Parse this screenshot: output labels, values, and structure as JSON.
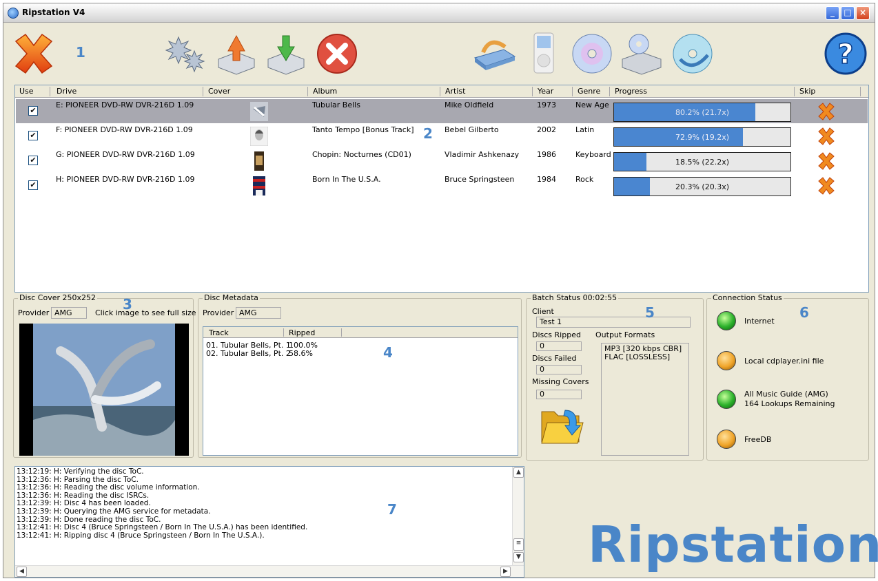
{
  "window": {
    "title": "Ripstation V4",
    "buttons": {
      "minimize": "_",
      "maximize": "□",
      "close": "×"
    }
  },
  "toolbar": {
    "steps": [
      "1",
      "2",
      "3",
      "4",
      "5",
      "6",
      "7"
    ],
    "icons": [
      "exit-icon",
      "settings-icon",
      "eject-icon",
      "load-icon",
      "cancel-icon",
      "drive-icon",
      "ipod-icon",
      "cd-icon",
      "rip-to-drive-icon",
      "rip-cd-icon",
      "help-icon"
    ]
  },
  "table": {
    "headers": [
      "Use",
      "Drive",
      "Cover",
      "Album",
      "Artist",
      "Year",
      "Genre",
      "Progress",
      "Skip"
    ],
    "rows": [
      {
        "use": "✔",
        "drive": "E: PIONEER  DVD-RW  DVR-216D 1.09",
        "album": "Tubular Bells",
        "artist": "Mike Oldfield",
        "year": "1973",
        "genre": "New Age",
        "progress": 0.802,
        "progress_text": "80.2% (21.7x)"
      },
      {
        "use": "✔",
        "drive": "F: PIONEER  DVD-RW  DVR-216D 1.09",
        "album": "Tanto Tempo [Bonus Track]",
        "artist": "Bebel Gilberto",
        "year": "2002",
        "genre": "Latin",
        "progress": 0.729,
        "progress_text": "72.9% (19.2x)"
      },
      {
        "use": "✔",
        "drive": "G: PIONEER  DVD-RW  DVR-216D 1.09",
        "album": "Chopin: Nocturnes (CD01)",
        "artist": "Vladimir Ashkenazy",
        "year": "1986",
        "genre": "Keyboard",
        "progress": 0.185,
        "progress_text": "18.5% (22.2x)"
      },
      {
        "use": "✔",
        "drive": "H: PIONEER  DVD-RW  DVR-216D 1.09",
        "album": "Born In The U.S.A.",
        "artist": "Bruce Springsteen",
        "year": "1984",
        "genre": "Rock",
        "progress": 0.203,
        "progress_text": "20.3% (20.3x)"
      }
    ]
  },
  "disc_cover": {
    "title": "Disc Cover 250x252",
    "provider_label": "Provider",
    "provider": "AMG",
    "hint": "Click image to see full size"
  },
  "metadata": {
    "title": "Disc Metadata",
    "provider_label": "Provider",
    "provider": "AMG",
    "headers": [
      "Track",
      "Ripped"
    ],
    "tracks": [
      {
        "track": "01. Tubular Bells, Pt. 1",
        "ripped": "100.0%"
      },
      {
        "track": "02. Tubular Bells, Pt. 2",
        "ripped": "58.6%"
      }
    ]
  },
  "batch": {
    "title": "Batch Status 00:02:55",
    "client_label": "Client",
    "client": "Test 1",
    "discs_ripped_label": "Discs Ripped",
    "discs_ripped": "0",
    "discs_failed_label": "Discs Failed",
    "discs_failed": "0",
    "missing_covers_label": "Missing Covers",
    "missing_covers": "0",
    "output_formats_label": "Output Formats",
    "output_formats": [
      "MP3 [320 kbps CBR]",
      "FLAC [LOSSLESS]"
    ]
  },
  "connection": {
    "title": "Connection Status",
    "items": [
      {
        "status": "green",
        "label": "Internet",
        "sub": ""
      },
      {
        "status": "orange",
        "label": "Local cdplayer.ini file",
        "sub": ""
      },
      {
        "status": "green",
        "label": "All Music Guide (AMG)",
        "sub": "164 Lookups Remaining"
      },
      {
        "status": "orange",
        "label": "FreeDB",
        "sub": ""
      }
    ]
  },
  "log": [
    "13:12:19: H: Verifying the disc ToC.",
    "13:12:36: H: Parsing the disc ToC.",
    "13:12:36: H: Reading the disc volume information.",
    "13:12:36: H: Reading the disc ISRCs.",
    "13:12:39: H: Disc 4 has been loaded.",
    "13:12:39: H: Querying the AMG service for metadata.",
    "13:12:39: H: Done reading the disc ToC.",
    "13:12:41: H: Disc 4 (Bruce Springsteen / Born In The U.S.A.) has been identified.",
    "13:12:41: H: Ripping disc 4 (Bruce Springsteen / Born In The U.S.A.)."
  ],
  "brand": "Ripstation",
  "colors": {
    "accent": "#4a86c8",
    "progress": "#4a86d0",
    "selected_row": "#a8a8b0"
  }
}
